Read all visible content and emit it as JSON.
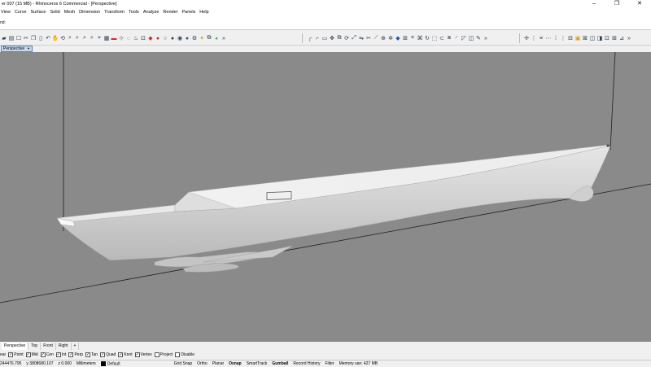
{
  "window": {
    "title": "er 007 (15 MB) - Rhinoceros 6 Commercial - [Perspective]",
    "minimize": "–",
    "maximize": "❐",
    "close": "✕"
  },
  "menu": [
    "View",
    "Curve",
    "Surface",
    "Solid",
    "Mesh",
    "Dimension",
    "Transform",
    "Tools",
    "Analyze",
    "Render",
    "Panels",
    "Help"
  ],
  "command": {
    "history": "",
    "prompt": "nd:"
  },
  "viewport": {
    "label": "Perspective",
    "colors": {
      "background": "#8a8a8a",
      "hull": "#dcdcdc",
      "deck": "#f2f2f2"
    }
  },
  "view_tabs": [
    "Perspective",
    "Top",
    "Front",
    "Right",
    "+"
  ],
  "osnaps": [
    {
      "label": "ear",
      "checked": false,
      "hidebox": true
    },
    {
      "label": "Point",
      "checked": true
    },
    {
      "label": "Mid",
      "checked": true
    },
    {
      "label": "Cen",
      "checked": true
    },
    {
      "label": "Int",
      "checked": true
    },
    {
      "label": "Perp",
      "checked": true
    },
    {
      "label": "Tan",
      "checked": true
    },
    {
      "label": "Quad",
      "checked": true
    },
    {
      "label": "Knot",
      "checked": true
    },
    {
      "label": "Vertex",
      "checked": true
    },
    {
      "label": "Project",
      "checked": false
    },
    {
      "label": "Disable",
      "checked": false
    }
  ],
  "status": {
    "x": "244476.795",
    "y": "y 3808680.107",
    "z": "z 0.000",
    "units": "Millimeters",
    "layer": "Default",
    "grid_snap": "Grid Snap",
    "ortho": "Ortho",
    "planar": "Planar",
    "osnap": "Osnap",
    "smarttrack": "SmartTrack",
    "gumball": "Gumball",
    "record_history": "Record History",
    "filter": "Filter",
    "memory": "Memory use: 427 MB"
  }
}
